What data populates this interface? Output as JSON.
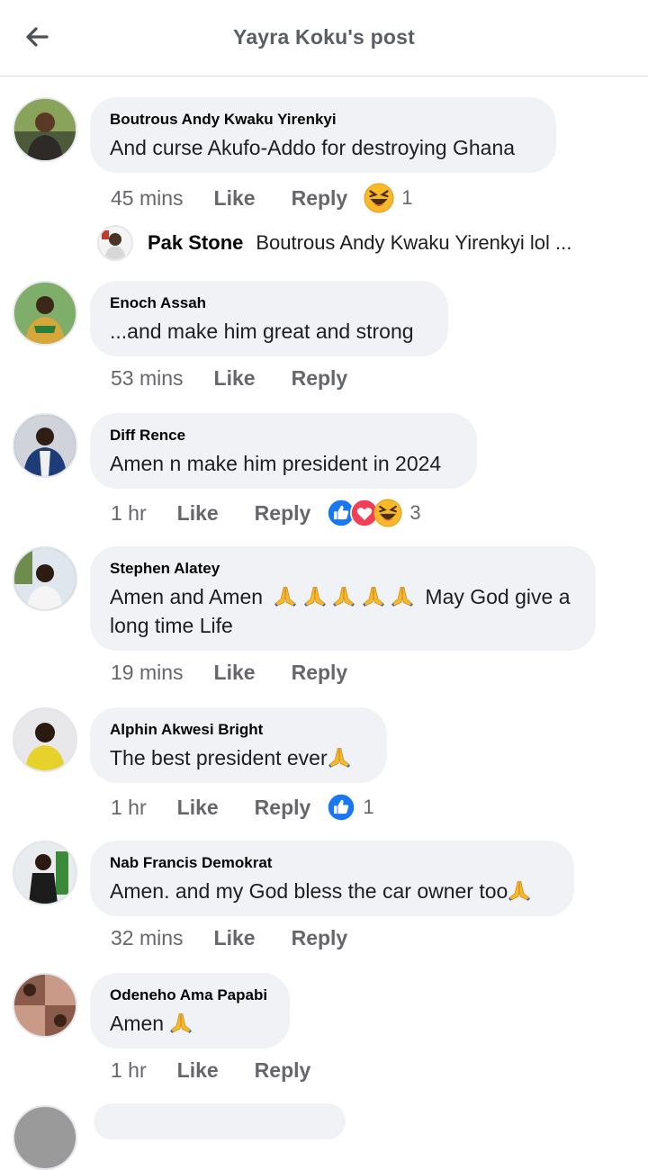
{
  "header": {
    "title": "Yayra Koku's post"
  },
  "comments": [
    {
      "name": "Boutrous Andy Kwaku Yirenkyi",
      "text": "And curse Akufo-Addo for destroying Ghana",
      "time": "45 mins",
      "like": "Like",
      "reply": "Reply",
      "reaction_count": "1",
      "reactions": [
        "haha"
      ]
    },
    {
      "name": "Enoch Assah",
      "text": "...and make him great and strong",
      "time": "53 mins",
      "like": "Like",
      "reply": "Reply"
    },
    {
      "name": "Diff Rence",
      "text": "Amen n make him president in 2024",
      "time": "1 hr",
      "like": "Like",
      "reply": "Reply",
      "reaction_count": "3",
      "reactions": [
        "like",
        "love",
        "haha"
      ]
    },
    {
      "name": "Stephen Alatey",
      "text_line1": "Amen and Amen",
      "text_line1_end": "May God give a",
      "text_line2": "long time Life",
      "time": "19 mins",
      "like": "Like",
      "reply": "Reply"
    },
    {
      "name": "Alphin Akwesi Bright",
      "text": "The best president ever",
      "time": "1 hr",
      "like": "Like",
      "reply": "Reply",
      "reaction_count": "1",
      "reactions": [
        "like"
      ]
    },
    {
      "name": "Nab Francis Demokrat",
      "text": "Amen. and my God bless the car owner too",
      "time": "32 mins",
      "like": "Like",
      "reply": "Reply"
    },
    {
      "name": "Odeneho Ama Papabi",
      "text": "Amen",
      "time": "1 hr",
      "like": "Like",
      "reply": "Reply"
    }
  ],
  "reply_preview": {
    "name": "Pak Stone",
    "text": "Boutrous Andy Kwaku Yirenkyi lol ..."
  },
  "colors": {
    "bubble": "#f0f2f5",
    "meta": "#65676b",
    "like_blue": "#1877f2",
    "love_red": "#f33e58",
    "haha_yellow": "#f7b928"
  }
}
